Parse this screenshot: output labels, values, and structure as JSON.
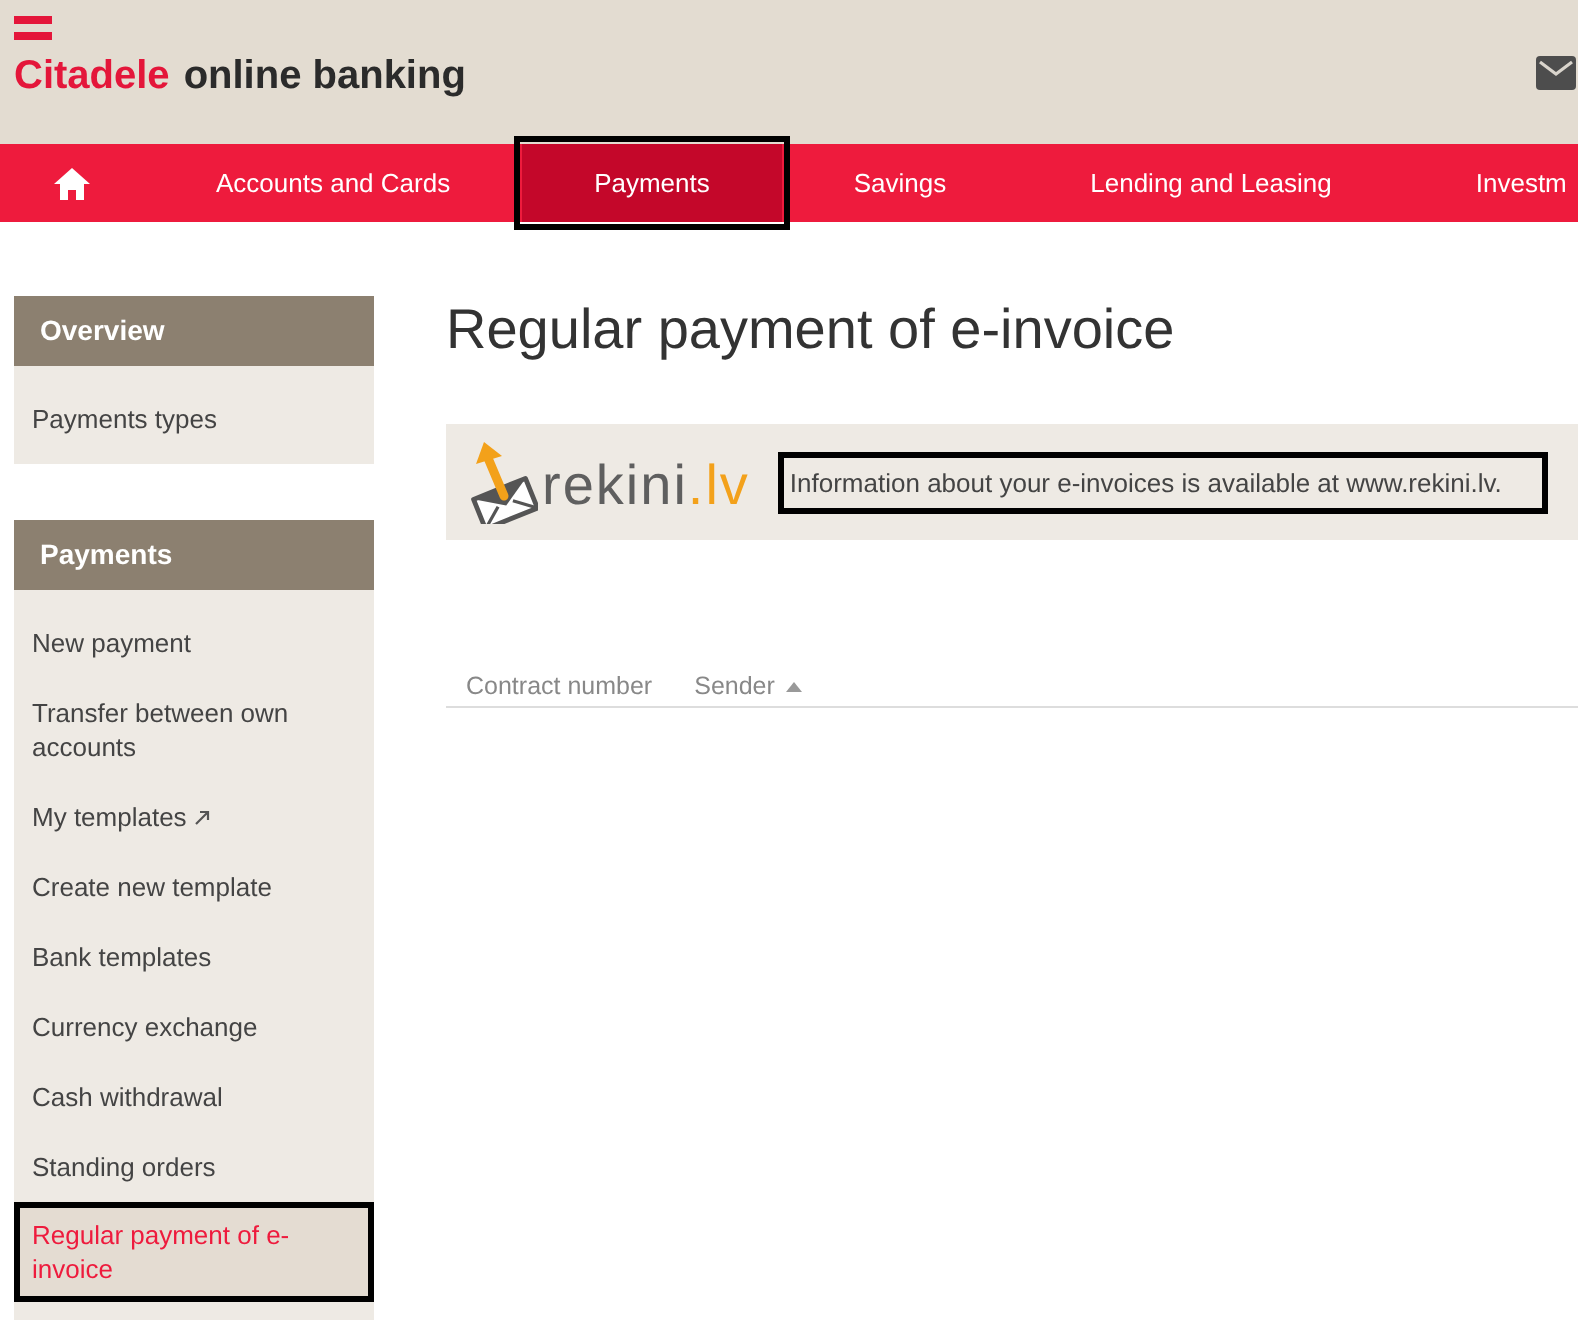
{
  "header": {
    "brand": "Citadele",
    "product": "online banking"
  },
  "nav": {
    "items": [
      {
        "label": "Accounts and Cards",
        "selected": false,
        "highlighted": false
      },
      {
        "label": "Payments",
        "selected": true,
        "highlighted": true
      },
      {
        "label": "Savings",
        "selected": false,
        "highlighted": false
      },
      {
        "label": "Lending and Leasing",
        "selected": false,
        "highlighted": false
      },
      {
        "label": "Investm",
        "selected": false,
        "highlighted": false
      }
    ]
  },
  "sidebar": {
    "sections": [
      {
        "title": "Overview",
        "items": [
          {
            "label": "Payments types",
            "selected": false,
            "highlighted": false,
            "external": false
          }
        ]
      },
      {
        "title": "Payments",
        "items": [
          {
            "label": "New payment",
            "selected": false,
            "highlighted": false,
            "external": false
          },
          {
            "label": "Transfer between own accounts",
            "selected": false,
            "highlighted": false,
            "external": false
          },
          {
            "label": "My templates",
            "selected": false,
            "highlighted": false,
            "external": true
          },
          {
            "label": "Create new template",
            "selected": false,
            "highlighted": false,
            "external": false
          },
          {
            "label": "Bank templates",
            "selected": false,
            "highlighted": false,
            "external": false
          },
          {
            "label": "Currency exchange",
            "selected": false,
            "highlighted": false,
            "external": false
          },
          {
            "label": "Cash withdrawal",
            "selected": false,
            "highlighted": false,
            "external": false
          },
          {
            "label": "Standing orders",
            "selected": false,
            "highlighted": false,
            "external": false
          },
          {
            "label": "Regular payment of e-invoice",
            "selected": true,
            "highlighted": true,
            "external": false
          }
        ]
      }
    ]
  },
  "page": {
    "title": "Regular payment of e-invoice"
  },
  "info_banner": {
    "logo_text": "rekini",
    "logo_suffix": ".lv",
    "message": "Information about your e-invoices is available at www.rekini.lv.",
    "highlighted": true
  },
  "table": {
    "columns": [
      {
        "label": "Contract number",
        "sorted": false
      },
      {
        "label": "Sender",
        "sorted": true
      }
    ]
  }
}
